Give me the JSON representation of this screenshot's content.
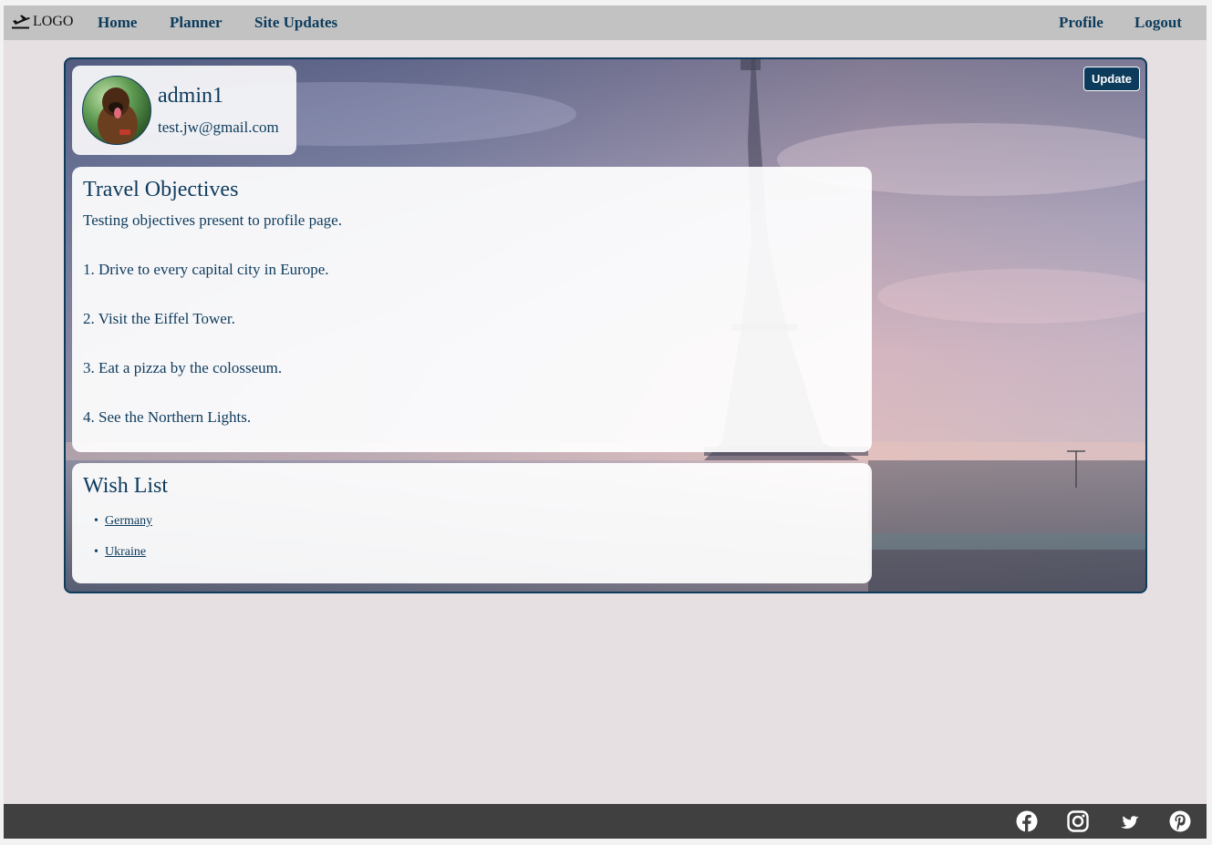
{
  "nav": {
    "logo_text": "LOGO",
    "logo_icon": "plane-departure-icon",
    "links": [
      "Home",
      "Planner",
      "Site Updates"
    ],
    "profile": "Profile",
    "logout": "Logout"
  },
  "profile": {
    "username": "admin1",
    "email": "test.jw@gmail.com",
    "update_label": "Update"
  },
  "objectives": {
    "heading": "Travel Objectives",
    "lines": [
      "Testing objectives present to profile page.",
      "1. Drive to every capital city in Europe.",
      "2. Visit the Eiffel Tower.",
      "3. Eat a pizza by the colosseum.",
      "4. See the Northern Lights."
    ]
  },
  "wishlist": {
    "heading": "Wish List",
    "items": [
      "Germany",
      "Ukraine"
    ]
  },
  "footer": {
    "icons": [
      "facebook-icon",
      "instagram-icon",
      "twitter-icon",
      "pinterest-icon"
    ]
  },
  "colors": {
    "accent": "#0d3b5c",
    "nav_bg": "#c2c2c2",
    "footer_bg": "#404040",
    "page_bg": "#e6e0e2"
  }
}
